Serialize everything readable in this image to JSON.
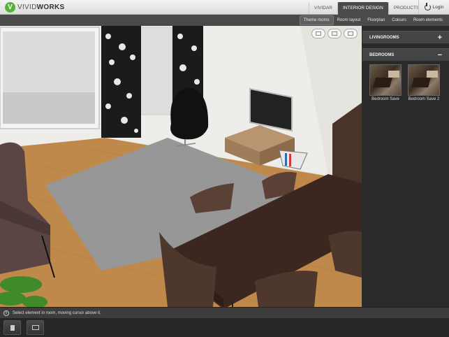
{
  "brand": {
    "mark": "V",
    "name_light": "VIVID",
    "name_bold": "WORKS"
  },
  "topnav": [
    {
      "label": "VIVIDAR",
      "active": false
    },
    {
      "label": "INTERIOR DESIGN",
      "active": true
    },
    {
      "label": "PRODUCTS",
      "active": false
    }
  ],
  "login_label": "Login",
  "subnav": [
    {
      "label": "Theme rooms",
      "active": true
    },
    {
      "label": "Room layout",
      "active": false
    },
    {
      "label": "Floorplan",
      "active": false
    },
    {
      "label": "Colours",
      "active": false
    },
    {
      "label": "Room elements",
      "active": false
    }
  ],
  "panel": {
    "sections": [
      {
        "label": "LIVINGROOMS",
        "sign": "+",
        "expanded": false
      },
      {
        "label": "BEDROOMS",
        "sign": "−",
        "expanded": true
      }
    ],
    "thumbnails": [
      {
        "label": "Bedroom Save"
      },
      {
        "label": "Bedroom Save 2"
      }
    ]
  },
  "status": {
    "icon": "info-icon",
    "text": "Select element in room, moving cursor above it."
  },
  "colors": {
    "accent_green": "#56b339",
    "nav_dark": "#4a4a4a",
    "panel_bg": "#2a2a2a"
  }
}
